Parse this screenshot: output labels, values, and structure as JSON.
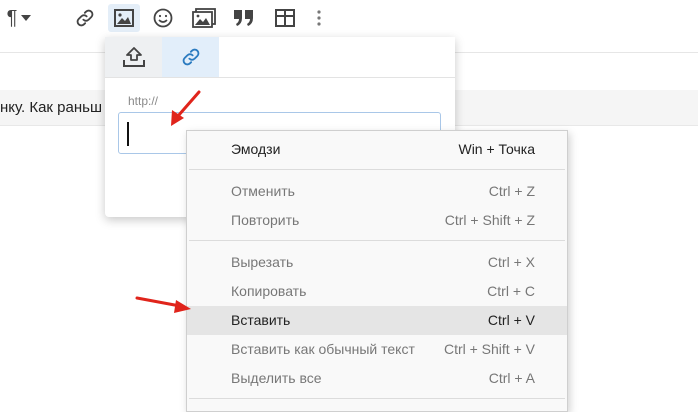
{
  "toolbar": {
    "paragraph_symbol": "¶",
    "icons": [
      "paragraph-icon",
      "link-icon",
      "image-icon",
      "smiley-icon",
      "media-gallery-icon",
      "quote-icon",
      "table-icon",
      "more-icon"
    ]
  },
  "editor": {
    "text_fragment": "нку. Как раньш"
  },
  "insert_image_popup": {
    "tabs": [
      "upload-icon",
      "link-icon"
    ],
    "active_tab": "link",
    "url_placeholder": "http://",
    "url_value": ""
  },
  "context_menu": {
    "items": [
      {
        "label": "Эмодзи",
        "shortcut": "Win + Точка",
        "enabled": true
      },
      {
        "label": "Отменить",
        "shortcut": "Ctrl + Z",
        "enabled": false
      },
      {
        "label": "Повторить",
        "shortcut": "Ctrl + Shift + Z",
        "enabled": false
      },
      {
        "label": "Вырезать",
        "shortcut": "Ctrl + X",
        "enabled": false
      },
      {
        "label": "Копировать",
        "shortcut": "Ctrl + C",
        "enabled": false
      },
      {
        "label": "Вставить",
        "shortcut": "Ctrl + V",
        "enabled": true,
        "highlighted": true
      },
      {
        "label": "Вставить как обычный текст",
        "shortcut": "Ctrl + Shift + V",
        "enabled": false
      },
      {
        "label": "Выделить все",
        "shortcut": "Ctrl + A",
        "enabled": false
      }
    ]
  },
  "colors": {
    "accent": "#2b7bc0",
    "annotation_arrow": "#e0241b",
    "menu_highlight": "#e5e5e5"
  }
}
